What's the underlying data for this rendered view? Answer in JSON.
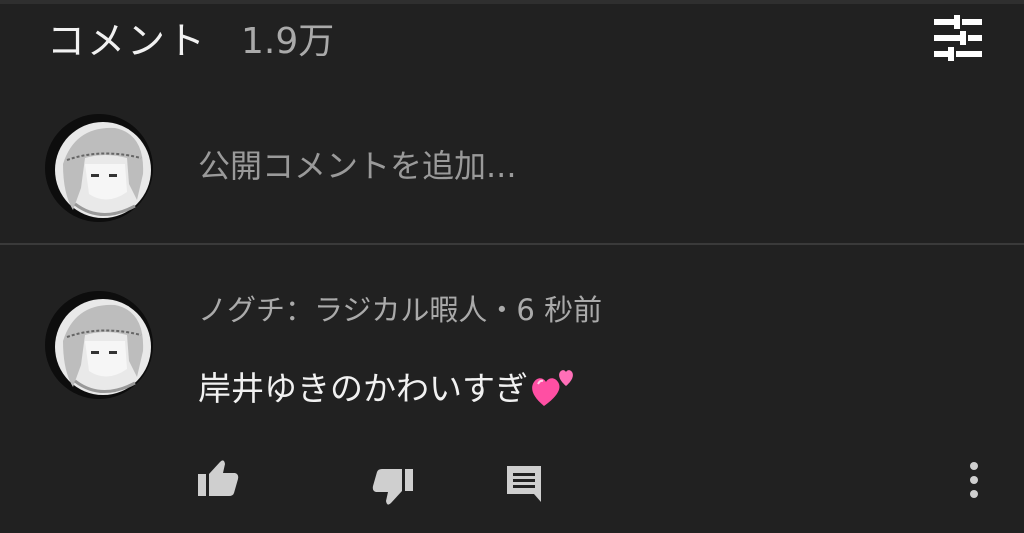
{
  "header": {
    "title": "コメント",
    "count": "1.9万",
    "sort_icon": "sort-filter-icon"
  },
  "composer": {
    "placeholder": "公開コメントを追加..."
  },
  "comments": [
    {
      "meta": "ノグチ：ラジカル暇人・6 秒前",
      "text": "岸井ゆきのかわいすぎ",
      "emoji": "two-hearts-emoji"
    }
  ],
  "actions": {
    "like_icon": "thumb-up-icon",
    "dislike_icon": "thumb-down-icon",
    "reply_icon": "reply-comment-icon",
    "more_icon": "more-vertical-icon"
  },
  "colors": {
    "background": "#212121",
    "text_primary": "#f1f1f1",
    "text_secondary": "#aaaaaa",
    "heart": "#ff4fa3"
  }
}
